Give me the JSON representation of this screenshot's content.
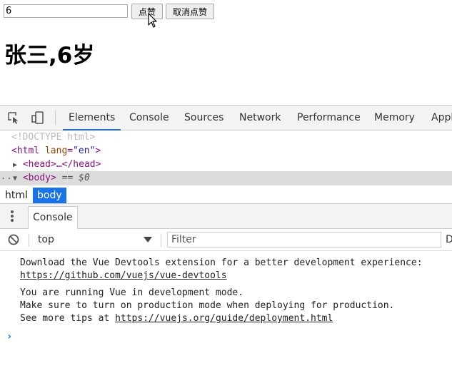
{
  "page": {
    "input_value": "6",
    "like_button": "点赞",
    "unlike_button": "取消点赞",
    "heading": "张三,6岁"
  },
  "devtools": {
    "tabs": [
      "Elements",
      "Console",
      "Sources",
      "Network",
      "Performance",
      "Memory",
      "Appl"
    ],
    "active_tab": "Elements",
    "elements": {
      "doctype": "<!DOCTYPE html>",
      "html_open": "<html",
      "html_attr": "lang",
      "html_attr_val": "\"en\"",
      "html_close": ">",
      "head": "<head>",
      "head_ellipsis": "…",
      "head_close": "</head>",
      "body": "<body>",
      "body_eq": "== $0",
      "dots": "..."
    },
    "breadcrumbs": [
      "html",
      "body"
    ],
    "drawer_tab": "Console",
    "console": {
      "context": "top",
      "filter_placeholder": "Filter",
      "level_truncated": "D",
      "messages": [
        {
          "line1": "Download the Vue Devtools extension for a better development experience:",
          "link": "https://github.com/vuejs/vue-devtools"
        },
        {
          "line1": "You are running Vue in development mode.",
          "line2": "Make sure to turn on production mode when deploying for production.",
          "line3_prefix": "See more tips at ",
          "link": "https://vuejs.org/guide/deployment.html"
        }
      ],
      "prompt": "›"
    }
  },
  "colors": {
    "accent": "#1a73e8",
    "tag": "#881280",
    "attr": "#994500",
    "attr_value": "#1a1aa6"
  }
}
